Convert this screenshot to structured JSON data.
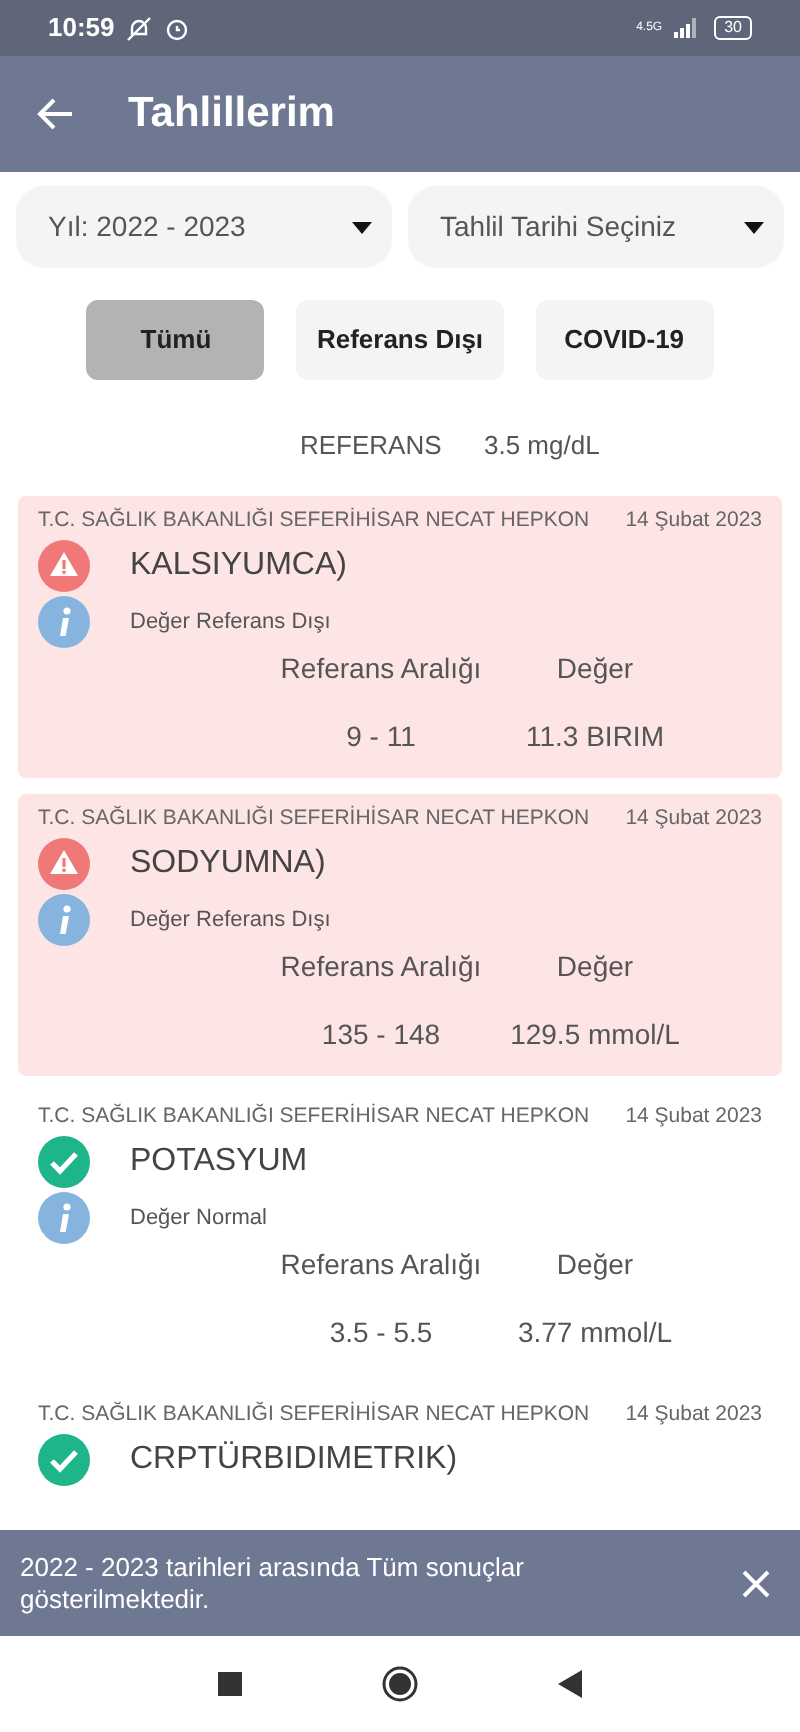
{
  "status_bar": {
    "time": "10:59",
    "network": "4.5G",
    "battery": "30"
  },
  "header": {
    "title": "Tahlillerim"
  },
  "filters": [
    {
      "label": "Yıl: 2022 - 2023"
    },
    {
      "label": "Tahlil Tarihi Seçiniz"
    }
  ],
  "tabs": [
    {
      "label": "Tümü",
      "selected": true
    },
    {
      "label": "Referans Dışı",
      "selected": false
    },
    {
      "label": "COVID-19",
      "selected": false
    }
  ],
  "partial_row": {
    "label": "REFERANS",
    "value": "3.5 mg/dL"
  },
  "results": [
    {
      "hospital": "T.C. SAĞLIK BAKANLIĞI SEFERİHİSAR NECAT HEPKON",
      "date": "14 Şubat 2023",
      "test": "KALSIYUMCA)",
      "status": "Değer Referans Dışı",
      "abnormal": true,
      "range_label": "Referans Aralığı",
      "value_label": "Değer",
      "range": "9 - 11",
      "value": "11.3 BIRIM"
    },
    {
      "hospital": "T.C. SAĞLIK BAKANLIĞI SEFERİHİSAR NECAT HEPKON",
      "date": "14 Şubat 2023",
      "test": "SODYUMNA)",
      "status": "Değer Referans Dışı",
      "abnormal": true,
      "range_label": "Referans Aralığı",
      "value_label": "Değer",
      "range": "135 - 148",
      "value": "129.5 mmol/L"
    },
    {
      "hospital": "T.C. SAĞLIK BAKANLIĞI SEFERİHİSAR NECAT HEPKON",
      "date": "14 Şubat 2023",
      "test": "POTASYUM",
      "status": "Değer Normal",
      "abnormal": false,
      "range_label": "Referans Aralığı",
      "value_label": "Değer",
      "range": "3.5 - 5.5",
      "value": "3.77 mmol/L"
    },
    {
      "hospital": "T.C. SAĞLIK BAKANLIĞI SEFERİHİSAR NECAT HEPKON",
      "date": "14 Şubat 2023",
      "test": "CRPTÜRBIDIMETRIK)",
      "abnormal": false
    }
  ],
  "snackbar": {
    "message": "2022 - 2023 tarihleri arasında Tüm sonuçlar gösterilmektedir."
  }
}
